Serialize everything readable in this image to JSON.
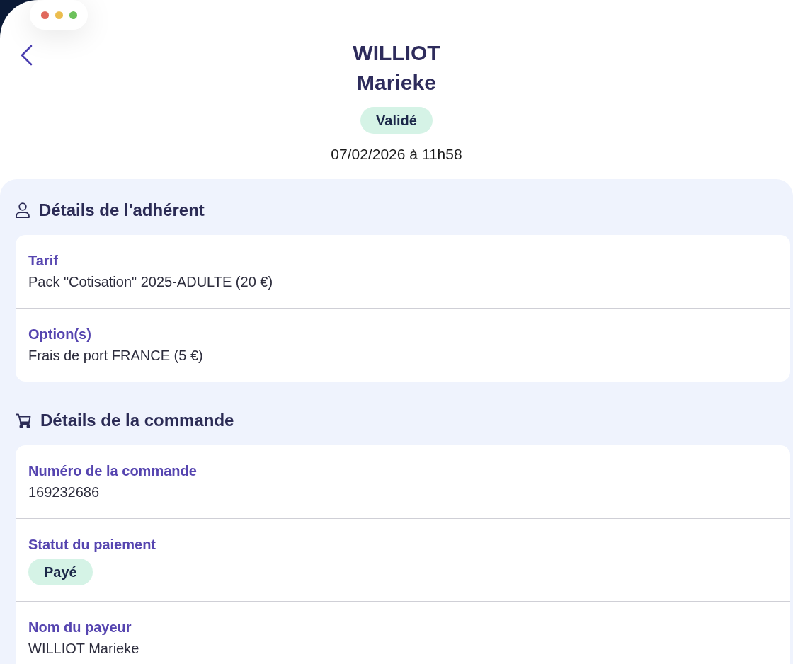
{
  "window_controls": [
    {
      "color": "#e0685c"
    },
    {
      "color": "#ebbd4e"
    },
    {
      "color": "#6cc15b"
    }
  ],
  "header": {
    "name_lines": [
      "WILLIOT",
      "Marieke"
    ],
    "status": "Validé",
    "date": "07/02/2026 à 11h58"
  },
  "sections": [
    {
      "kind": "member",
      "title": "Détails de l'adhérent",
      "fields": [
        {
          "kind": "text",
          "label": "Tarif",
          "value": "Pack \"Cotisation\" 2025-ADULTE (20 €)"
        },
        {
          "kind": "text",
          "label": "Option(s)",
          "value": "Frais de port FRANCE (5 €)"
        }
      ]
    },
    {
      "kind": "order",
      "title": "Détails de la commande",
      "fields": [
        {
          "kind": "text",
          "label": "Numéro de la commande",
          "value": "169232686"
        },
        {
          "kind": "badge",
          "label": "Statut du paiement",
          "value": "Payé"
        },
        {
          "kind": "text",
          "label": "Nom du payeur",
          "value": "WILLIOT Marieke"
        }
      ]
    }
  ]
}
